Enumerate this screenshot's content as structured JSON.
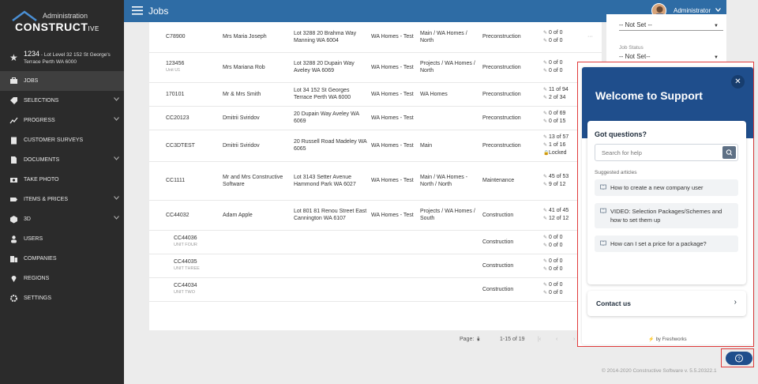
{
  "app": {
    "admin_label": "Administration",
    "brand": "CONSTRUCT",
    "brand_suffix": "IVE"
  },
  "job_context": {
    "number": "1234",
    "address": "- Lot Level 32 152 St George's Terrace Perth WA 6000"
  },
  "nav": [
    {
      "label": "JOBS",
      "icon": "briefcase-icon",
      "active": true
    },
    {
      "label": "SELECTIONS",
      "icon": "tag-icon",
      "chevron": true
    },
    {
      "label": "PROGRESS",
      "icon": "trend-icon",
      "chevron": true
    },
    {
      "label": "CUSTOMER SURVEYS",
      "icon": "clipboard-icon"
    },
    {
      "label": "DOCUMENTS",
      "icon": "document-icon",
      "chevron": true
    },
    {
      "label": "TAKE PHOTO",
      "icon": "camera-icon"
    },
    {
      "label": "ITEMS & PRICES",
      "icon": "label-icon",
      "chevron": true
    },
    {
      "label": "3D",
      "icon": "cube-icon",
      "chevron": true
    },
    {
      "label": "USERS",
      "icon": "user-icon"
    },
    {
      "label": "COMPANIES",
      "icon": "building-icon"
    },
    {
      "label": "REGIONS",
      "icon": "pin-icon"
    },
    {
      "label": "SETTINGS",
      "icon": "gear-icon"
    }
  ],
  "topbar": {
    "title": "Jobs",
    "user": "Administrator"
  },
  "filters": {
    "prev_value": "-- Not Set --",
    "job_status_label": "Job Status",
    "job_status_value": "-- Not Set--"
  },
  "rows": [
    {
      "code": "C78900",
      "unit": "",
      "client": "Mrs Maria Joseph",
      "address": "Lot 3288 20 Brahma Way Manning WA 6004",
      "company": "WA Homes - Test",
      "region": "Main / WA Homes / North",
      "stage": "Preconstruction",
      "c1": "0 of 0",
      "c2": "0 of 0",
      "c3": "",
      "more": "···"
    },
    {
      "code": "123456",
      "unit": "Unit U1",
      "client": "Mrs Mariana Rob",
      "address": "Lot 3288 20 Dupain Way Aveley WA 6069",
      "company": "WA Homes - Test",
      "region": "Projects / WA Homes / North",
      "stage": "Preconstruction",
      "c1": "0 of 0",
      "c2": "0 of 0",
      "c3": ""
    },
    {
      "code": "170101",
      "unit": "",
      "client": "Mr & Mrs Smith",
      "address": "Lot 34 152 St Georges Terrace Perth WA 6000",
      "company": "WA Homes - Test",
      "region": "WA Homes",
      "stage": "Preconstruction",
      "c1": "11 of 94",
      "c2": "2 of 34",
      "c3": ""
    },
    {
      "code": "CC20123",
      "unit": "",
      "client": "Dmitrii Sviridov",
      "address": "20 Dupain Way Aveley WA 6069",
      "company": "WA Homes - Test",
      "region": "",
      "stage": "Preconstruction",
      "c1": "0 of 69",
      "c2": "0 of 15",
      "c3": ""
    },
    {
      "code": "CC3DTEST",
      "unit": "",
      "client": "Dmitrii Sviridov",
      "address": "20 Russell Road Madeley WA 6065",
      "company": "WA Homes - Test",
      "region": "Main",
      "stage": "Preconstruction",
      "c1": "13 of 57",
      "c2": "1 of 16",
      "c3": "Locked"
    },
    {
      "code": "CC1111",
      "unit": "",
      "client": "Mr and Mrs Constructive Software",
      "address": "Lot 3143 Setter Avenue Hammond Park WA 6027",
      "company": "WA Homes - Test",
      "region": "Main / WA Homes - North / North",
      "stage": "Maintenance",
      "c1": "45 of 53",
      "c2": "9 of 12",
      "c3": ""
    },
    {
      "code": "CC44032",
      "unit": "",
      "client": "Adam Apple",
      "address": "Lot 801 81 Renou Street East Cannington WA 6107",
      "company": "WA Homes - Test",
      "region": "Projects / WA Homes / South",
      "stage": "Construction",
      "c1": "41 of 45",
      "c2": "12 of 12",
      "c3": ""
    },
    {
      "code": "CC44036",
      "unit": "UNIT FOUR",
      "client": "",
      "address": "",
      "company": "",
      "region": "",
      "stage": "Construction",
      "c1": "0 of 0",
      "c2": "0 of 0",
      "c3": "",
      "child": true
    },
    {
      "code": "CC44035",
      "unit": "UNIT THREE",
      "client": "",
      "address": "",
      "company": "",
      "region": "",
      "stage": "Construction",
      "c1": "0 of 0",
      "c2": "0 of 0",
      "c3": "",
      "child": true
    },
    {
      "code": "CC44034",
      "unit": "UNIT TWO",
      "client": "",
      "address": "",
      "company": "",
      "region": "",
      "stage": "Construction",
      "c1": "0 of 0",
      "c2": "0 of 0",
      "c3": "",
      "child": true
    }
  ],
  "pager": {
    "page_label": "Page:",
    "page": "1",
    "range": "1-15 of 19"
  },
  "widget": {
    "title": "Welcome to Support",
    "questions": "Got questions?",
    "search_placeholder": "Search for help",
    "suggested": "Suggested articles",
    "articles": [
      "How to create a new company user",
      "VIDEO: Selection Packages/Schemes and how to set them up",
      "How can I set a price for a package?"
    ],
    "contact": "Contact us",
    "powered": "by Freshworks"
  },
  "footer": "© 2014-2020 Constructive Software   v. 5.5.20322.1"
}
